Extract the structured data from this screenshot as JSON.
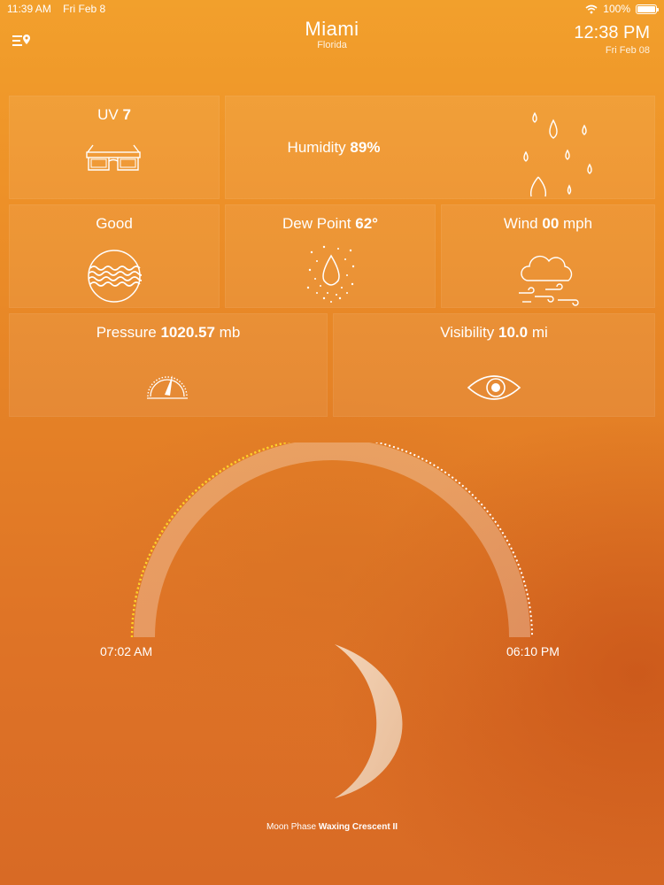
{
  "status": {
    "time": "11:39 AM",
    "date": "Fri Feb 8",
    "battery": "100%"
  },
  "header": {
    "city": "Miami",
    "region": "Florida",
    "time": "12:38 PM",
    "date": "Fri Feb 08"
  },
  "tiles": {
    "uv": {
      "label": "UV",
      "value": "7"
    },
    "humidity": {
      "label": "Humidity",
      "value": "89%"
    },
    "air_quality": {
      "label": "Good"
    },
    "dew_point": {
      "label": "Dew Point",
      "value": "62°"
    },
    "wind": {
      "label": "Wind",
      "value": "00",
      "unit": "mph"
    },
    "pressure": {
      "label": "Pressure",
      "value": "1020.57",
      "unit": "mb"
    },
    "visibility": {
      "label": "Visibility",
      "value": "10.0",
      "unit": "mi"
    }
  },
  "sun": {
    "sunrise": "07:02 AM",
    "sunset": "06:10 PM"
  },
  "moon": {
    "label": "Moon Phase",
    "phase": "Waxing Crescent II"
  },
  "colors": {
    "background_top": "#f2a02c",
    "background_bottom": "#d86a25",
    "sun_progress": "#ffd21e"
  }
}
